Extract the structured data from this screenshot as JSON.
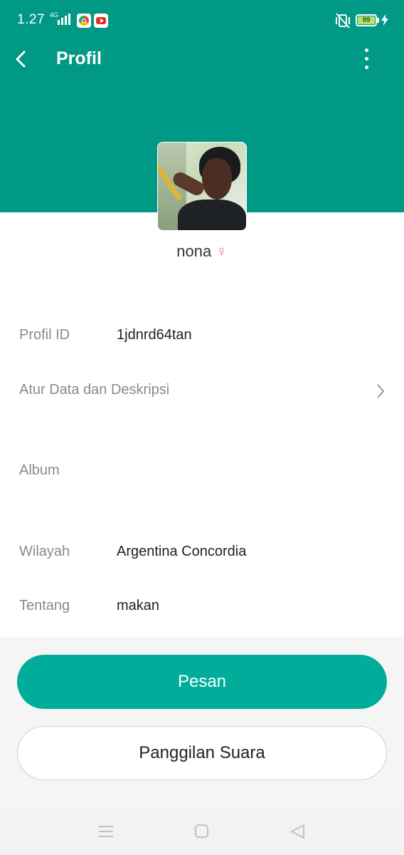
{
  "status_bar": {
    "time": "1.27",
    "network": "4G",
    "battery": "99",
    "apps": [
      "chrome-icon",
      "youtube-icon"
    ]
  },
  "app_bar": {
    "title": "Profil",
    "back_icon": "chevron-left-icon",
    "menu_icon": "more-vertical-icon"
  },
  "profile": {
    "name": "nona",
    "gender_symbol": "♀",
    "accent_color": "#009985"
  },
  "details": {
    "profile_id_label": "Profil ID",
    "profile_id_value": "1jdnrd64tan",
    "edit_label": "Atur Data dan Deskripsi",
    "album_label": "Album",
    "region_label": "Wilayah",
    "region_value": "Argentina Concordia",
    "about_label": "Tentang",
    "about_value": "makan"
  },
  "actions": {
    "message_label": "Pesan",
    "voice_call_label": "Panggilan Suara",
    "primary_color": "#00ad9b"
  },
  "nav_bar": {
    "icons": [
      "menu-icon",
      "home-icon",
      "back-triangle-icon"
    ]
  }
}
